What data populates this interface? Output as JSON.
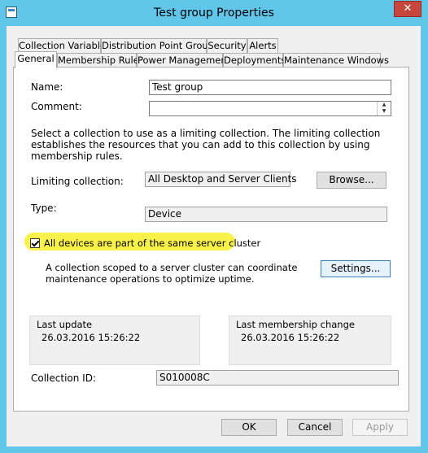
{
  "window": {
    "title": "Test group Properties",
    "close_glyph": "✕"
  },
  "tabs_row1": [
    "Collection Variables",
    "Distribution Point Groups",
    "Security",
    "Alerts"
  ],
  "tabs_row2": [
    "General",
    "Membership Rules",
    "Power Management",
    "Deployments",
    "Maintenance Windows"
  ],
  "general": {
    "name_label": "Name:",
    "name_value": "Test group",
    "comment_label": "Comment:",
    "comment_value": "",
    "description": "Select a collection to use as a limiting collection. The limiting collection establishes the resources that you can add to this collection by using membership rules.",
    "limiting_label": "Limiting collection:",
    "limiting_value": "All Desktop and Server Clients",
    "browse_label": "Browse...",
    "type_label": "Type:",
    "type_value": "Device",
    "cluster_check_label": "All devices are part of the same server cluster",
    "cluster_checked": true,
    "cluster_desc": "A collection scoped to a server cluster can coordinate maintenance operations to optimize uptime.",
    "settings_label": "Settings...",
    "last_update_label": "Last update",
    "last_update_value": "26.03.2016 15:26:22",
    "last_membership_label": "Last membership change",
    "last_membership_value": "26.03.2016 15:26:22",
    "collection_id_label": "Collection ID:",
    "collection_id_value": "S010008C"
  },
  "footer": {
    "ok": "OK",
    "cancel": "Cancel",
    "apply": "Apply"
  },
  "colors": {
    "titlebar": "#62c6ea",
    "close": "#c7473e",
    "highlight": "#f8f24a"
  }
}
